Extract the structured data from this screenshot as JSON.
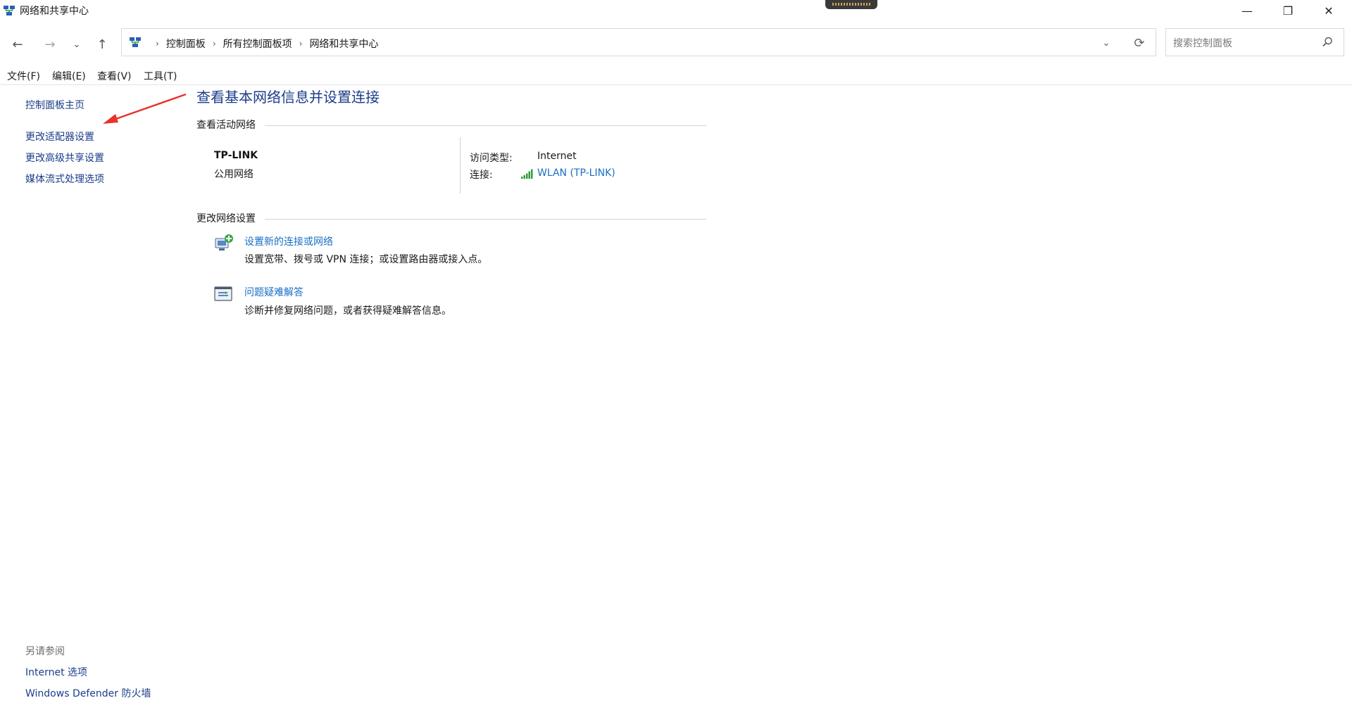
{
  "window": {
    "title": "网络和共享中心",
    "minimize_glyph": "—",
    "restore_glyph": "❐",
    "close_glyph": "✕"
  },
  "nav": {
    "back_glyph": "←",
    "forward_glyph": "→",
    "recent_glyph": "⌄",
    "up_glyph": "↑",
    "dropdown_glyph": "⌄",
    "refresh_glyph": "⟳"
  },
  "breadcrumb": {
    "items": [
      "控制面板",
      "所有控制面板项",
      "网络和共享中心"
    ],
    "separator": "›"
  },
  "search": {
    "placeholder": "搜索控制面板"
  },
  "menu": {
    "items": [
      "文件(F)",
      "编辑(E)",
      "查看(V)",
      "工具(T)"
    ]
  },
  "sidebar": {
    "items": [
      "控制面板主页",
      "更改适配器设置",
      "更改高级共享设置",
      "媒体流式处理选项"
    ],
    "see_also_title": "另请参阅",
    "see_also_items": [
      "Internet 选项",
      "Windows Defender 防火墙"
    ]
  },
  "main": {
    "heading": "查看基本网络信息并设置连接",
    "active_network_title": "查看活动网络",
    "network": {
      "name": "TP-LINK",
      "type": "公用网络",
      "access_label": "访问类型:",
      "access_value": "Internet",
      "connection_label": "连接:",
      "connection_value": "WLAN (TP-LINK)"
    },
    "change_settings_title": "更改网络设置",
    "tasks": [
      {
        "label": "设置新的连接或网络",
        "desc": "设置宽带、拨号或 VPN 连接；或设置路由器或接入点。",
        "icon": "network-setup-icon"
      },
      {
        "label": "问题疑难解答",
        "desc": "诊断并修复网络问题，或者获得疑难解答信息。",
        "icon": "troubleshoot-icon"
      }
    ]
  },
  "annotation": {
    "arrow_color": "#e8322b"
  },
  "colors": {
    "link": "#1a6fc4",
    "sidebar_link": "#1a3d8a",
    "heading": "#1a3d8a",
    "signal": "#2e9e3a"
  }
}
